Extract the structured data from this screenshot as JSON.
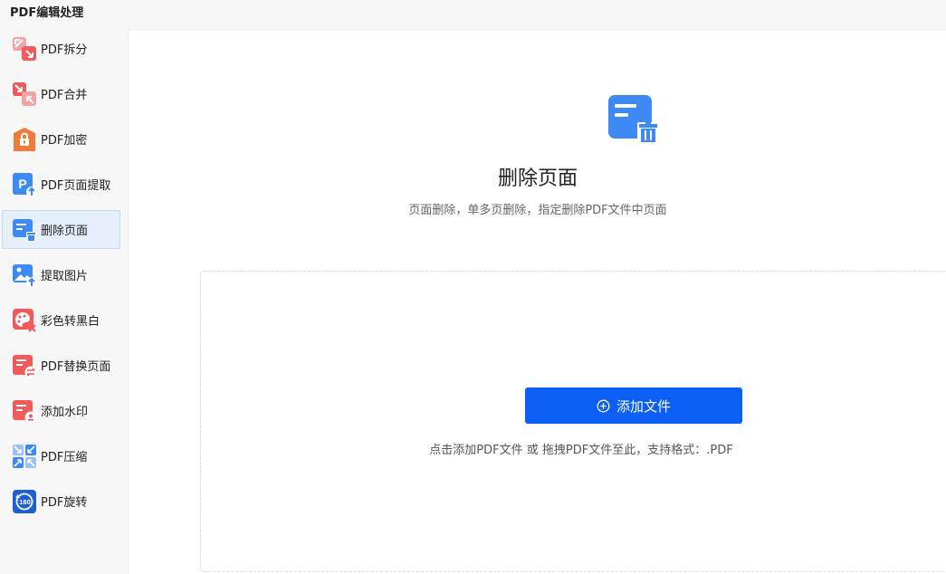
{
  "app": {
    "title": "PDF编辑处理"
  },
  "sidebar": {
    "items": [
      {
        "label": "PDF拆分",
        "icon": "split-icon"
      },
      {
        "label": "PDF合并",
        "icon": "merge-icon"
      },
      {
        "label": "PDF加密",
        "icon": "lock-icon"
      },
      {
        "label": "PDF页面提取",
        "icon": "page-extract-icon"
      },
      {
        "label": "删除页面",
        "icon": "delete-page-icon",
        "active": true
      },
      {
        "label": "提取图片",
        "icon": "image-extract-icon"
      },
      {
        "label": "彩色转黑白",
        "icon": "color-to-bw-icon"
      },
      {
        "label": "PDF替换页面",
        "icon": "replace-page-icon"
      },
      {
        "label": "添加水印",
        "icon": "watermark-icon"
      },
      {
        "label": "PDF压缩",
        "icon": "compress-icon"
      },
      {
        "label": "PDF旋转",
        "icon": "rotate-icon"
      }
    ]
  },
  "main": {
    "title": "删除页面",
    "description": "页面删除，单多页删除，指定删除PDF文件中页面",
    "add_button": "添加文件",
    "drop_hint": "点击添加PDF文件 或 拖拽PDF文件至此，支持格式：.PDF"
  },
  "colors": {
    "accent": "#0b5ff5",
    "active_bg": "#e6f0fb",
    "icon_blue": "#3d8af7",
    "icon_red": "#f25a5a",
    "icon_orange": "#f37b3a"
  }
}
